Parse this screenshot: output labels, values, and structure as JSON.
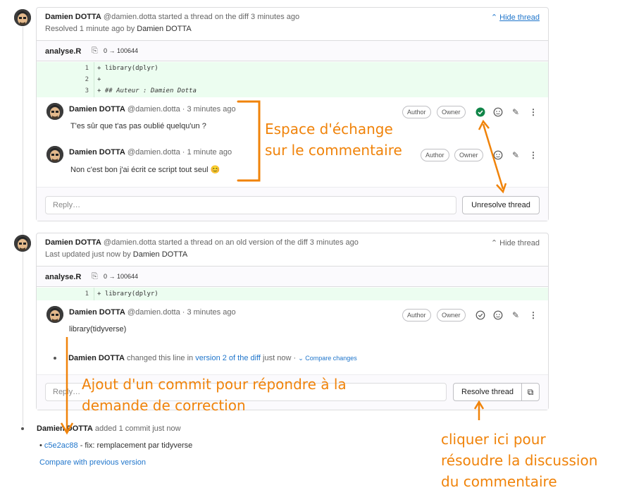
{
  "thread1": {
    "author_name": "Damien DOTTA",
    "author_handle": "@damien.dotta",
    "action": "started a thread on the diff 3 minutes ago",
    "status": "Resolved 1 minute ago by",
    "status_user": "Damien DOTTA",
    "toggle_label": "Hide thread",
    "file_name": "analyse.R",
    "file_mode": "0 → 100644",
    "diff_lines": [
      {
        "num": "1",
        "code": "+ library(dplyr)"
      },
      {
        "num": "2",
        "code": "+"
      },
      {
        "num": "3",
        "code": "+ ## Auteur : Damien Dotta"
      }
    ],
    "notes": [
      {
        "author": "Damien DOTTA",
        "handle": "@damien.dotta",
        "time": "· 3 minutes ago",
        "body": "T'es sûr que t'as pas oublié quelqu'un ?",
        "badges": [
          "Author",
          "Owner"
        ]
      },
      {
        "author": "Damien DOTTA",
        "handle": "@damien.dotta",
        "time": "· 1 minute ago",
        "body": "Non c'est bon j'ai écrit ce script tout seul 😊",
        "badges": [
          "Author",
          "Owner"
        ]
      }
    ],
    "reply_placeholder": "Reply…",
    "unresolve_label": "Unresolve thread"
  },
  "thread2": {
    "author_name": "Damien DOTTA",
    "author_handle": "@damien.dotta",
    "action": "started a thread on an old version of the diff 3 minutes ago",
    "status": "Last updated just now by",
    "status_user": "Damien DOTTA",
    "toggle_label": "Hide thread",
    "file_name": "analyse.R",
    "file_mode": "0 → 100644",
    "diff_lines": [
      {
        "num": "1",
        "code": "+ library(dplyr)"
      }
    ],
    "note": {
      "author": "Damien DOTTA",
      "handle": "@damien.dotta",
      "time": "· 3 minutes ago",
      "body": "library(tidyverse)",
      "badges": [
        "Author",
        "Owner"
      ]
    },
    "system_note": {
      "author": "Damien DOTTA",
      "text1": "changed this line in",
      "link": "version 2 of the diff",
      "text2": "just now ·",
      "compare": "Compare changes"
    },
    "reply_placeholder": "Reply…",
    "resolve_label": "Resolve thread"
  },
  "commit_event": {
    "author": "Damien DOTTA",
    "text": "added 1 commit just now",
    "sha": "c5e2ac88",
    "message": "- fix: remplacement par tidyverse",
    "compare_link": "Compare with previous version"
  },
  "annotations": {
    "exchange": [
      "Espace d'échange",
      "sur le commentaire"
    ],
    "commit": [
      "Ajout d'un commit pour répondre à la",
      "demande de correction"
    ],
    "resolve": [
      "cliquer ici pour",
      "résoudre la discussion",
      "du commentaire"
    ]
  },
  "colors": {
    "annotation": "#f0830a",
    "link": "#1f75cb",
    "resolved_check": "#108548",
    "diff_bg": "#ecfdf0"
  }
}
